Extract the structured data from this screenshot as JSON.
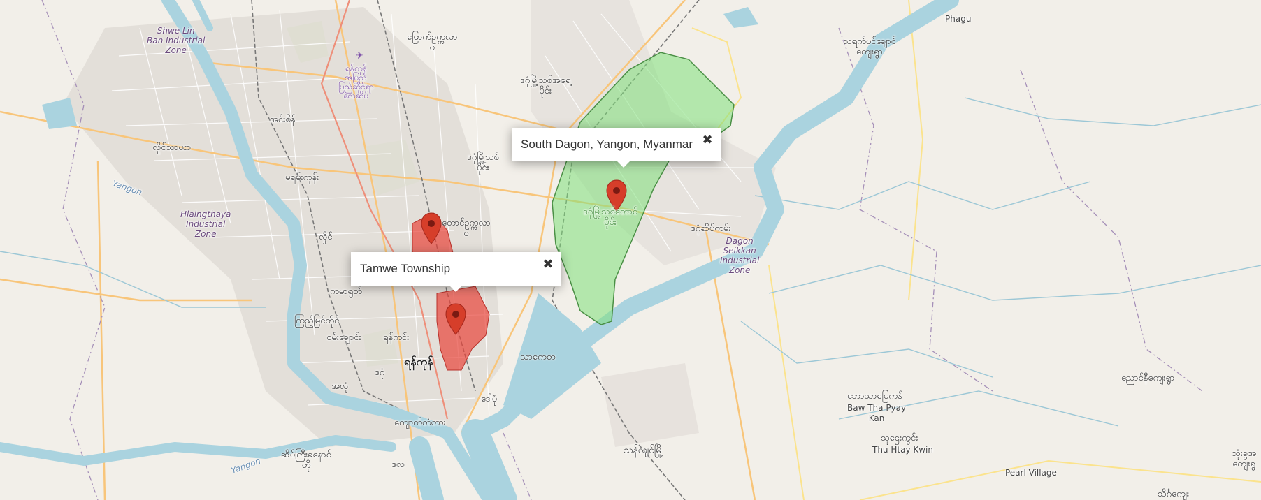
{
  "popups": {
    "south_dagon": {
      "text": "South Dagon, Yangon, Myanmar",
      "close": "✖"
    },
    "tamwe": {
      "text": "Tamwe Township",
      "close": "✖"
    }
  },
  "labels": {
    "shwe_lin": "Shwe Lin\nBan Industrial\nZone",
    "airport": "ရန်ကုန်\nအပြည်\nပြည်ဆိုင်ရာ\nလေဆိပ်",
    "mayangone": "မြောက်ဥက္ကလာ\nပ",
    "north_dagon": "ဒဂုံမြို့သစ်အရှေ့\nပိုင်း",
    "insein": "အင်းစိန်",
    "hlaing_tharyar": "လှိုင်သာယာ",
    "mayangone2": "မရမ်းကုန်း",
    "yangon_river1": "Yangon",
    "hlaingthaya_zone": "Hlaingthaya\nIndustrial\nZone",
    "hlaing": "လှိုင်",
    "dagon_seikkan_my": "ဒဂုံဆိပ်ကမ်း",
    "dagon_seikkan_zone": "Dagon\nSeikkan\nIndustrial\nZone",
    "south_dagon_my": "ဒဂုံမြို့သစ်တောင်\nပိုင်း",
    "north_dagon2": "ဒဂုံမြို့သစ်\nပိုင်း",
    "south_okkalapa": "တောင်ဥက္ကလာ\nပ",
    "kamayut": "ကမာရွတ်",
    "kyimyindaing": "ကြည့်မြင်တိုင်",
    "sanchaung": "စမ်းချောင်း",
    "yankin": "ရန်ကင်း",
    "yangon_big": "ရန်ကုန်",
    "dagon": "ဒဂုံ",
    "ahlone": "အလုံ",
    "thaketa": "သာကေတ",
    "dawbon": "ဒေါပုံ",
    "kyauktada": "ကျောက်တံတား",
    "seikkyi": "ဆိပ်ကြီးခနောင်\nတို",
    "dala": "ဒလ",
    "yangon_river2": "Yangon",
    "thanlyin": "သန်လျင်မြို့",
    "phagu": "Phagu",
    "thayet_chaung": "သရက်ပင်ချောင်\nကျေးရွာ",
    "baw_tha_my": "ဘောသာပြေကန်",
    "baw_tha_en": "Baw Tha Pyay\nKan",
    "thu_htay_my": "သုဌေးကွင်း",
    "thu_htay_en": "Thu Htay Kwin",
    "pearl_village": "Pearl Village",
    "hnin_si": "ညောင်နီကျေးရွာ",
    "right_edge": "သုံးခွအ\nကျေးရွ",
    "bottom_right": "သိင်္ဂကျေး"
  },
  "colors": {
    "land": "#f2efe9",
    "water": "#aad3df",
    "highlight_green": "#7fe07a",
    "highlight_red": "#e8443a",
    "marker": "#d63e2a"
  },
  "markers": [
    "red-marker",
    "red-marker",
    "red-marker"
  ]
}
